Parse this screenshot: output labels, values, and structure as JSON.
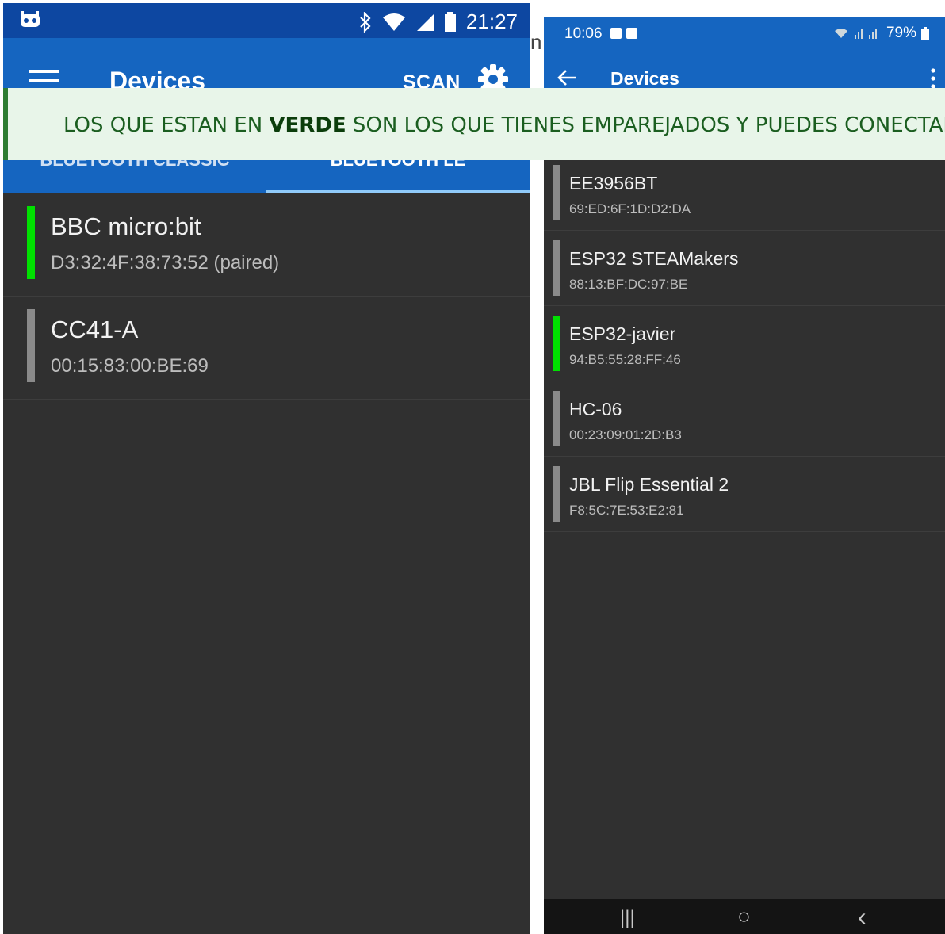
{
  "left_phone": {
    "status": {
      "time": "21:27",
      "icon_names": [
        "robot-icon",
        "bluetooth-icon",
        "wifi-icon",
        "signal-icon",
        "battery-icon"
      ]
    },
    "appbar": {
      "title": "Devices",
      "scan_label": "SCAN"
    },
    "tabs": [
      {
        "label": "BLUETOOTH CLASSIC",
        "selected": false
      },
      {
        "label": "BLUETOOTH LE",
        "selected": true
      }
    ],
    "devices": [
      {
        "name": "BBC micro:bit",
        "address": "D3:32:4F:38:73:52 (paired)",
        "paired": true
      },
      {
        "name": "CC41-A",
        "address": "00:15:83:00:BE:69",
        "paired": false
      }
    ]
  },
  "right_phone": {
    "status": {
      "time": "10:06",
      "battery": "79%"
    },
    "appbar": {
      "title": "Devices"
    },
    "devices": [
      {
        "name": "EE3956BT",
        "address": "69:ED:6F:1D:D2:DA",
        "paired": false
      },
      {
        "name": "ESP32 STEAMakers",
        "address": "88:13:BF:DC:97:BE",
        "paired": false
      },
      {
        "name": "ESP32-javier",
        "address": "94:B5:55:28:FF:46",
        "paired": true
      },
      {
        "name": "HC-06",
        "address": "00:23:09:01:2D:B3",
        "paired": false
      },
      {
        "name": "JBL Flip Essential 2",
        "address": "F8:5C:7E:53:E2:81",
        "paired": false
      }
    ],
    "nav": {
      "recents": "|||",
      "home": "○",
      "back": "‹"
    }
  },
  "banner": {
    "before": "LOS QUE ESTAN EN ",
    "bold": "VERDE",
    "after": " SON LOS QUE TIENES EMPAREJADOS Y PUEDES CONECTAR"
  },
  "stray_char": "n",
  "colors": {
    "appbar_blue": "#1565c0",
    "status_blue_left": "#0d47a1",
    "paired_green": "#00e000",
    "unpaired_gray": "#8a8a8a",
    "list_bg": "#303030"
  }
}
